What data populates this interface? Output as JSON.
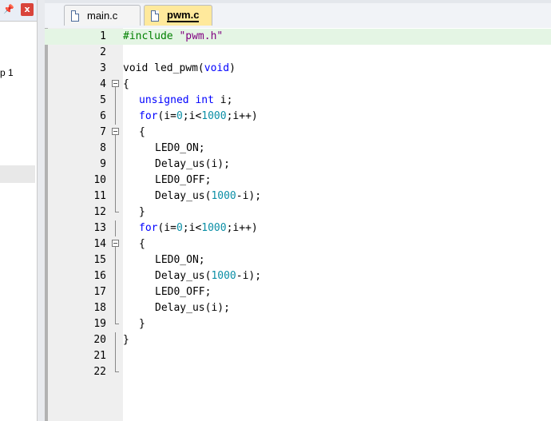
{
  "left_panel": {
    "pin_glyph": "p",
    "close_glyph": "x",
    "tree_label": "p 1"
  },
  "tabs": [
    {
      "label": "main.c",
      "active": false
    },
    {
      "label": "pwm.c",
      "active": true
    }
  ],
  "colors": {
    "keyword": "#0000ff",
    "preprocessor": "#008000",
    "string": "#800080",
    "number": "#0b8fa6",
    "active_tab": "#ffe99c",
    "current_line": "#e4f5e4"
  },
  "code": {
    "lines": [
      {
        "n": "1",
        "fold": "",
        "indent": 0,
        "tokens": [
          {
            "t": "#include ",
            "c": "pp"
          },
          {
            "t": "\"pwm.h\"",
            "c": "str"
          }
        ]
      },
      {
        "n": "2",
        "fold": "",
        "indent": 0,
        "tokens": []
      },
      {
        "n": "3",
        "fold": "",
        "indent": 0,
        "tokens": [
          {
            "t": "void",
            "c": ""
          },
          {
            "t": " led_pwm(",
            "c": ""
          },
          {
            "t": "void",
            "c": "kw"
          },
          {
            "t": ")",
            "c": ""
          }
        ]
      },
      {
        "n": "4",
        "fold": "open",
        "indent": 0,
        "tokens": [
          {
            "t": "{",
            "c": ""
          }
        ]
      },
      {
        "n": "5",
        "fold": "line",
        "indent": 2,
        "tokens": [
          {
            "t": "unsigned",
            "c": "kw"
          },
          {
            "t": " ",
            "c": ""
          },
          {
            "t": "int",
            "c": "kw"
          },
          {
            "t": " i;",
            "c": ""
          }
        ]
      },
      {
        "n": "6",
        "fold": "line",
        "indent": 2,
        "tokens": [
          {
            "t": "for",
            "c": "kw"
          },
          {
            "t": "(i=",
            "c": ""
          },
          {
            "t": "0",
            "c": "num"
          },
          {
            "t": ";i<",
            "c": ""
          },
          {
            "t": "1000",
            "c": "num"
          },
          {
            "t": ";i++)",
            "c": ""
          }
        ]
      },
      {
        "n": "7",
        "fold": "open",
        "indent": 2,
        "tokens": [
          {
            "t": "{",
            "c": ""
          }
        ]
      },
      {
        "n": "8",
        "fold": "line",
        "indent": 4,
        "tokens": [
          {
            "t": "LED0_ON;",
            "c": ""
          }
        ]
      },
      {
        "n": "9",
        "fold": "line",
        "indent": 4,
        "tokens": [
          {
            "t": "Delay_us(i);",
            "c": ""
          }
        ]
      },
      {
        "n": "10",
        "fold": "line",
        "indent": 4,
        "tokens": [
          {
            "t": "LED0_OFF;",
            "c": ""
          }
        ]
      },
      {
        "n": "11",
        "fold": "line",
        "indent": 4,
        "tokens": [
          {
            "t": "Delay_us(",
            "c": ""
          },
          {
            "t": "1000",
            "c": "num"
          },
          {
            "t": "-i);",
            "c": ""
          }
        ]
      },
      {
        "n": "12",
        "fold": "end",
        "indent": 2,
        "tokens": [
          {
            "t": "}",
            "c": ""
          }
        ]
      },
      {
        "n": "13",
        "fold": "line",
        "indent": 2,
        "tokens": [
          {
            "t": "for",
            "c": "kw"
          },
          {
            "t": "(i=",
            "c": ""
          },
          {
            "t": "0",
            "c": "num"
          },
          {
            "t": ";i<",
            "c": ""
          },
          {
            "t": "1000",
            "c": "num"
          },
          {
            "t": ";i++)",
            "c": ""
          }
        ]
      },
      {
        "n": "14",
        "fold": "open",
        "indent": 2,
        "tokens": [
          {
            "t": "{",
            "c": ""
          }
        ]
      },
      {
        "n": "15",
        "fold": "line",
        "indent": 4,
        "tokens": [
          {
            "t": "LED0_ON;",
            "c": ""
          }
        ]
      },
      {
        "n": "16",
        "fold": "line",
        "indent": 4,
        "tokens": [
          {
            "t": "Delay_us(",
            "c": ""
          },
          {
            "t": "1000",
            "c": "num"
          },
          {
            "t": "-i);",
            "c": ""
          }
        ]
      },
      {
        "n": "17",
        "fold": "line",
        "indent": 4,
        "tokens": [
          {
            "t": "LED0_OFF;",
            "c": ""
          }
        ]
      },
      {
        "n": "18",
        "fold": "line",
        "indent": 4,
        "tokens": [
          {
            "t": "Delay_us(i);",
            "c": ""
          }
        ]
      },
      {
        "n": "19",
        "fold": "end",
        "indent": 2,
        "tokens": [
          {
            "t": "}",
            "c": ""
          }
        ]
      },
      {
        "n": "20",
        "fold": "line",
        "indent": 0,
        "tokens": [
          {
            "t": "}",
            "c": ""
          }
        ]
      },
      {
        "n": "21",
        "fold": "line",
        "indent": 0,
        "tokens": []
      },
      {
        "n": "22",
        "fold": "end",
        "indent": 0,
        "tokens": []
      }
    ]
  }
}
